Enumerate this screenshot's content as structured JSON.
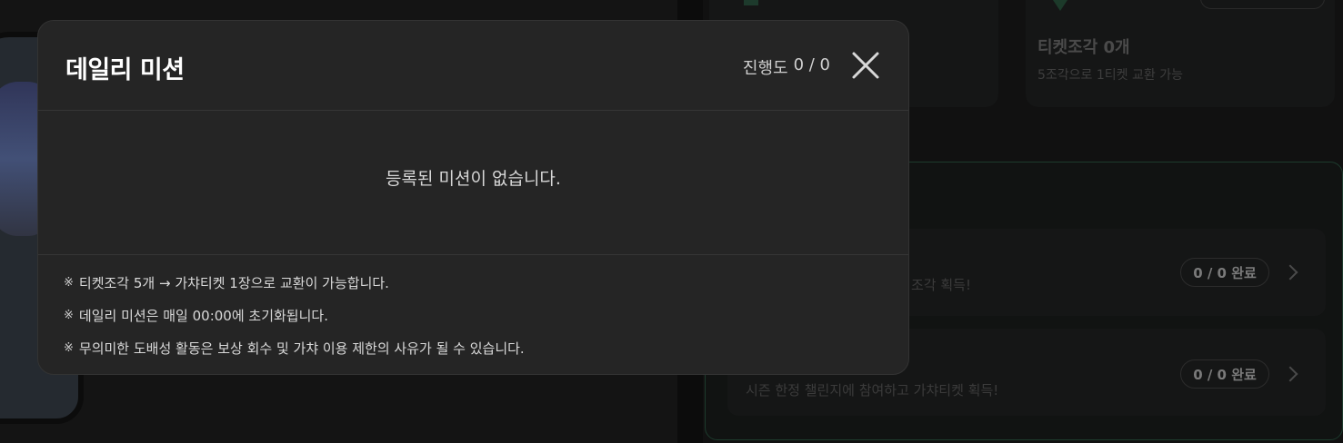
{
  "background": {
    "ticket_title": "티켓조각 0개",
    "ticket_subtitle": "5조각으로 1티켓 교환 가능",
    "challenge_rows": [
      {
        "description": "조각 획득!",
        "status": "0 / 0 완료"
      },
      {
        "description": "시즌 한정 챌린지에 참여하고 가챠티켓 획득!",
        "status": "0 / 0 완료"
      }
    ]
  },
  "modal": {
    "title": "데일리 미션",
    "progress_label": "진행도",
    "progress_value": "0 / 0",
    "empty_message": "등록된 미션이 없습니다.",
    "note_mark": "※",
    "notes": [
      "티켓조각 5개 → 가챠티켓 1장으로 교환이 가능합니다.",
      "데일리 미션은 매일 00:00에 초기화됩니다.",
      "무의미한 도배성 활동은 보상 회수 및 가챠 이용 제한의 사유가 될 수 있습니다."
    ],
    "close_icon": "close-icon"
  },
  "colors": {
    "modal_bg": "#252525",
    "page_bg": "#101010",
    "accent_border": "#1d3b2d"
  }
}
